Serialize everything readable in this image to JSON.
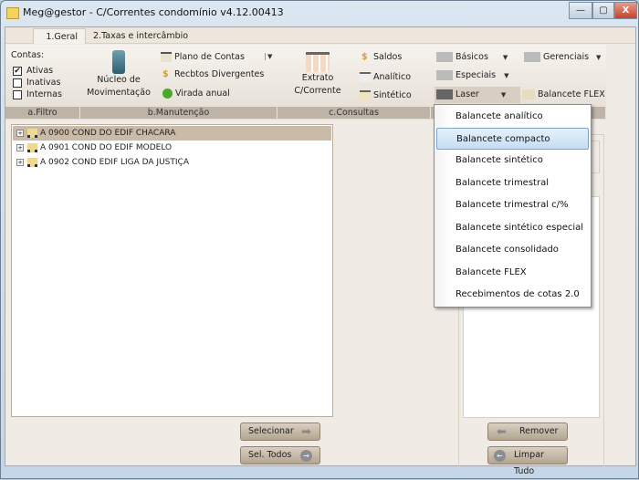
{
  "window": {
    "title": "Meg@gestor - C/Correntes condomínio v4.12.00413",
    "min": "—",
    "max": "▢",
    "close": "X"
  },
  "tabs": [
    {
      "label": "1.Geral",
      "active": true
    },
    {
      "label": "2.Taxas e intercâmbio",
      "active": false
    }
  ],
  "ribbon": {
    "filtro": {
      "label": "a.Filtro",
      "title": "Contas:",
      "checks": [
        {
          "label": "Ativas",
          "checked": true,
          "mark": "✔"
        },
        {
          "label": "Inativas",
          "checked": false
        },
        {
          "label": "Internas",
          "checked": false
        }
      ]
    },
    "manutencao": {
      "label": "b.Manutenção",
      "big": "Núcleo de Movimentação",
      "items": [
        "Plano de Contas",
        "Recbtos Divergentes",
        "Virada anual"
      ]
    },
    "consultas": {
      "label": "c.Consultas",
      "big": "Extrato C/Corrente",
      "items": [
        "Saldos",
        "Analítico",
        "Sintético"
      ]
    },
    "relatorios": {
      "items": [
        "Básicos",
        "Especiais",
        "Laser",
        "Gerenciais",
        "Balancete FLEX"
      ]
    }
  },
  "tree": [
    {
      "label": "A 0900 COND DO EDIF CHACARA",
      "selected": true
    },
    {
      "label": "A 0901 COND DO EDIF MODELO",
      "selected": false
    },
    {
      "label": "A 0902 COND EDIF LIGA DA JUSTIÇA",
      "selected": false
    }
  ],
  "buttons": {
    "selecionar": "Selecionar",
    "sel_todos": "Sel. Todos",
    "remover": "Remover",
    "limpar": "Limpar Tudo"
  },
  "menu": {
    "items": [
      "Balancete analítico",
      "Balancete compacto",
      "Balancete sintético",
      "Balancete trimestral",
      "Balancete trimestral c/%",
      "Balancete sintético especial",
      "Balancete consolidado",
      "Balancete FLEX",
      "Recebimentos de cotas 2.0"
    ],
    "highlighted": 1
  },
  "colors": {
    "highlight": "#c5ddf4",
    "selected_row": "#c9bba8",
    "group_label": "#bdb4a7"
  }
}
